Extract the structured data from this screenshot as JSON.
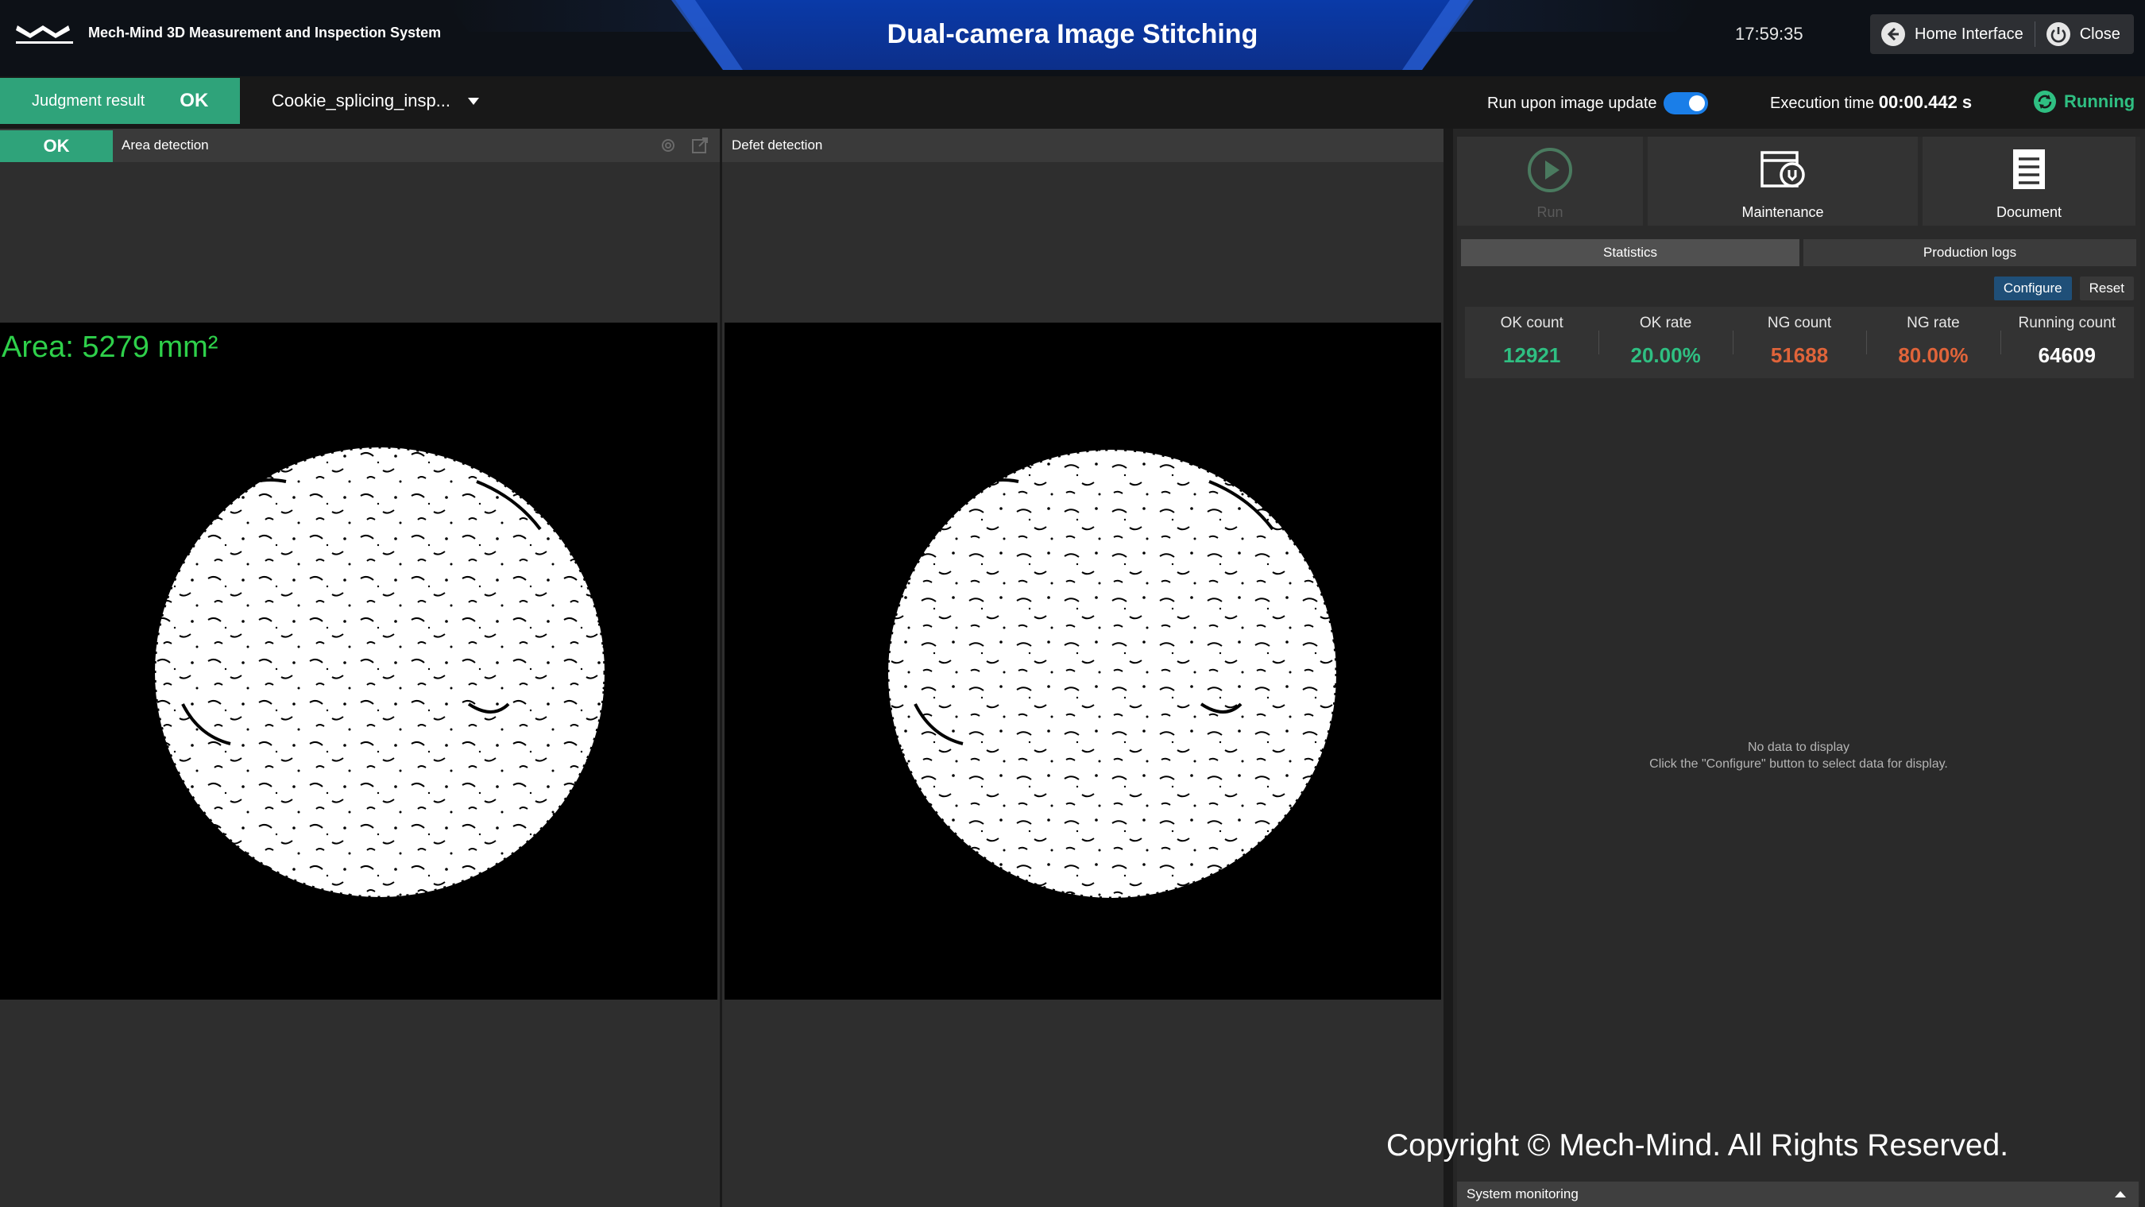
{
  "header": {
    "logo_text": "MECH-MIND",
    "system_name": "Mech-Mind 3D Measurement and Inspection System",
    "title": "Dual-camera Image Stitching",
    "clock": "17:59:35",
    "home_label": "Home Interface",
    "close_label": "Close"
  },
  "toolbar": {
    "judgment_label": "Judgment result",
    "judgment_value": "OK",
    "project_name": "Cookie_splicing_insp...",
    "run_on_update_label": "Run upon image update",
    "run_on_update_enabled": true,
    "exec_label": "Execution time",
    "exec_value": "00:00.442 s",
    "status": "Running",
    "status_color": "#2fbf82",
    "ok_color": "#2fa37a"
  },
  "panels": {
    "left": {
      "result": "OK",
      "title": "Area detection",
      "overlay": "Area: 5279 mm²",
      "icons": [
        "settings-icon",
        "open-external-icon"
      ]
    },
    "right": {
      "title": "Defet detection"
    }
  },
  "side": {
    "actions": [
      {
        "label": "Run",
        "icon": "play-icon",
        "enabled": false
      },
      {
        "label": "Maintenance",
        "icon": "maintenance-icon",
        "enabled": true
      },
      {
        "label": "Document",
        "icon": "document-icon",
        "enabled": true
      }
    ],
    "tabs": [
      "Statistics",
      "Production logs"
    ],
    "configure_label": "Configure",
    "reset_label": "Reset",
    "stats": [
      {
        "label": "OK count",
        "value": "12921",
        "color": "#2fbf82"
      },
      {
        "label": "OK rate",
        "value": "20.00%",
        "color": "#2fbf82"
      },
      {
        "label": "NG count",
        "value": "51688",
        "color": "#e0643a"
      },
      {
        "label": "NG rate",
        "value": "80.00%",
        "color": "#e0643a"
      },
      {
        "label": "Running count",
        "value": "64609",
        "color": "#ffffff"
      }
    ],
    "no_data_line1": "No data to display",
    "no_data_line2": "Click the \"Configure\" button to select data for display.",
    "system_monitoring": "System monitoring"
  },
  "watermark": "Copyright © Mech-Mind. All Rights Reserved."
}
